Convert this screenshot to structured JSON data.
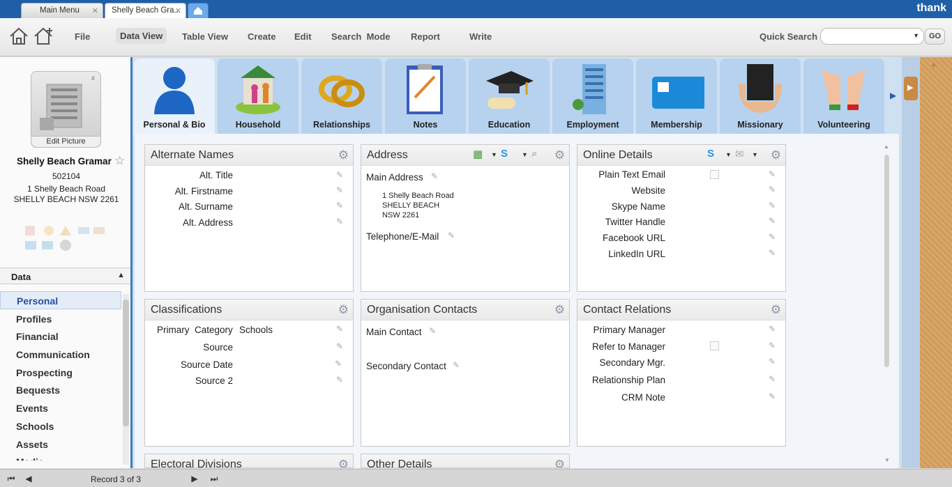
{
  "tabs": [
    {
      "label": "Main Menu"
    },
    {
      "label": "Shelly Beach Gra..."
    }
  ],
  "brand": "thank",
  "toolbar": {
    "menu": [
      "File",
      "Data View",
      "Table View",
      "Create",
      "Edit",
      "Search  Mode",
      "Report",
      "Write"
    ],
    "quick_search_label": "Quick Search",
    "go_label": "GO"
  },
  "record": {
    "edit_picture": "Edit Picture",
    "name": "Shelly Beach Gramar",
    "id": "502104",
    "address_line1": "1 Shelly Beach Road",
    "address_line2": "SHELLY BEACH NSW 2261"
  },
  "data_section": {
    "title": "Data",
    "items": [
      "Personal",
      "Profiles",
      "Financial",
      "Communication",
      "Prospecting",
      "Bequests",
      "Events",
      "Schools",
      "Assets",
      "Media"
    ]
  },
  "categories": [
    "Personal & Bio",
    "Household",
    "Relationships",
    "Notes",
    "Education",
    "Employment",
    "Membership",
    "Missionary",
    "Volunteering"
  ],
  "cards": {
    "alternate_names": {
      "title": "Alternate Names",
      "fields": [
        "Alt. Title",
        "Alt. Firstname",
        "Alt. Surname",
        "Alt. Address"
      ]
    },
    "address": {
      "title": "Address",
      "main_label": "Main Address",
      "lines": [
        "1 Shelly Beach Road",
        "SHELLY BEACH",
        "NSW 2261"
      ],
      "telephone_label": "Telephone/E-Mail"
    },
    "online": {
      "title": "Online Details",
      "fields": [
        "Plain Text Email",
        "Website",
        "Skype Name",
        "Twitter Handle",
        "Facebook URL",
        "LinkedIn URL"
      ]
    },
    "classifications": {
      "title": "Classifications",
      "primary_label": "Primary  Category",
      "primary_value": "Schools",
      "fields": [
        "Source",
        "Source Date",
        "Source 2"
      ]
    },
    "org_contacts": {
      "title": "Organisation Contacts",
      "fields": [
        "Main Contact",
        "Secondary Contact"
      ]
    },
    "contact_relations": {
      "title": "Contact Relations",
      "fields": [
        "Primary Manager",
        "Refer to Manager",
        "Secondary Mgr.",
        "Relationship Plan",
        "CRM Note"
      ]
    },
    "electoral": {
      "title": "Electoral Divisions"
    },
    "other": {
      "title": "Other Details"
    }
  },
  "footer": {
    "record_count": "Record 3 of 3"
  },
  "colors": {
    "tabbar": "#1f5fa8",
    "accent": "#3e7cc0",
    "tab_bg": "#b7d2ee"
  }
}
